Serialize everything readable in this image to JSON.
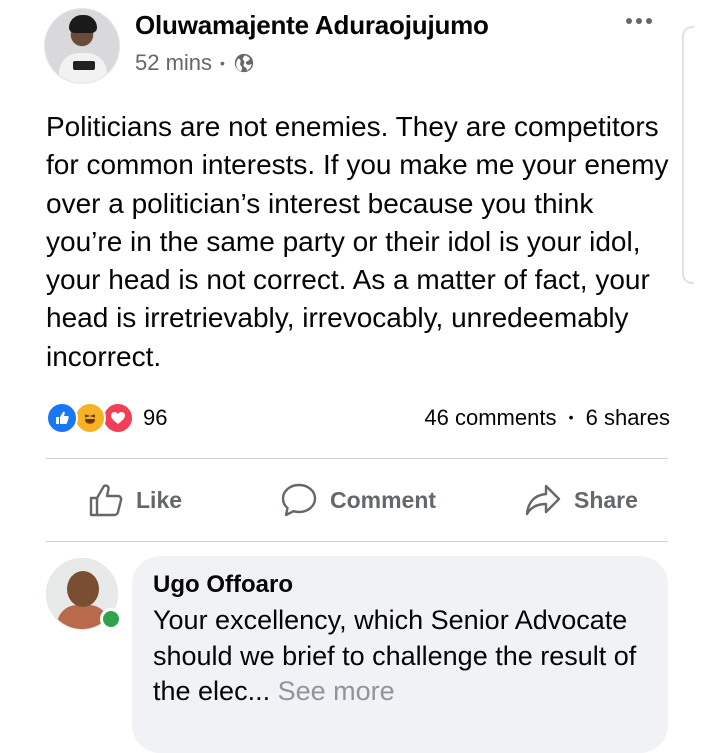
{
  "post": {
    "author": "Oluwamajente Aduraojujumo",
    "time": "52 mins",
    "separator": "•",
    "privacy_icon": "globe-icon",
    "body": "Politicians are not enemies. They are competitors for common interests. If you make me your enemy over a politician’s interest because you think you’re in the same party or their idol is your idol, your head is not correct. As a matter of fact, your head is irretrievably, irrevocably, unredeemably incorrect."
  },
  "reactions": {
    "types": [
      "like",
      "haha",
      "love"
    ],
    "count": "96",
    "comments": "46 comments",
    "separator": "•",
    "shares": "6 shares"
  },
  "actions": {
    "like_label": "Like",
    "comment_label": "Comment",
    "share_label": "Share"
  },
  "comment": {
    "author": "Ugo Offoaro",
    "text": "Your excellency, which Senior Advocate should we brief to challenge the result of the elec...",
    "see_more": "See more"
  },
  "colors": {
    "like_blue": "#1877f2",
    "haha_yellow": "#f7b125",
    "love_red": "#f33e58",
    "online_green": "#31a24c",
    "secondary_text": "#65676b",
    "bubble_bg": "#f0f2f5"
  }
}
